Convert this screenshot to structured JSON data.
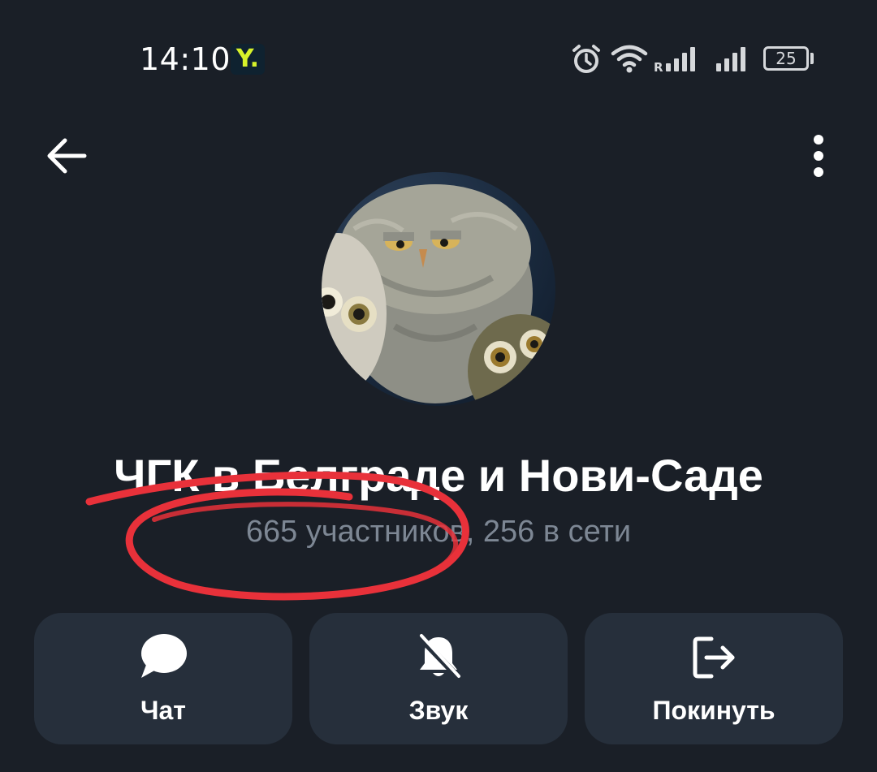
{
  "status_bar": {
    "time": "14:10",
    "app_badge": "Y.",
    "signal_roaming_marker": "R",
    "battery_level": "25",
    "icons": [
      "alarm-icon",
      "wifi-icon",
      "signal-roaming-icon",
      "signal-icon",
      "battery-icon"
    ]
  },
  "header": {
    "back_icon": "arrow-left-icon",
    "menu_icon": "more-vertical-icon"
  },
  "profile": {
    "avatar_description": "owls-group-avatar",
    "title": "ЧГК в Белграде и Нови-Саде",
    "subtitle": "665 участников, 256 в сети"
  },
  "actions": [
    {
      "label": "Чат",
      "icon": "chat-bubble-icon"
    },
    {
      "label": "Звук",
      "icon": "bell-muted-icon"
    },
    {
      "label": "Покинуть",
      "icon": "leave-icon"
    }
  ],
  "colors": {
    "background": "#1a1f27",
    "button_bg": "#262f3b",
    "subtitle": "#7d8794",
    "annotation": "#e8313a"
  }
}
